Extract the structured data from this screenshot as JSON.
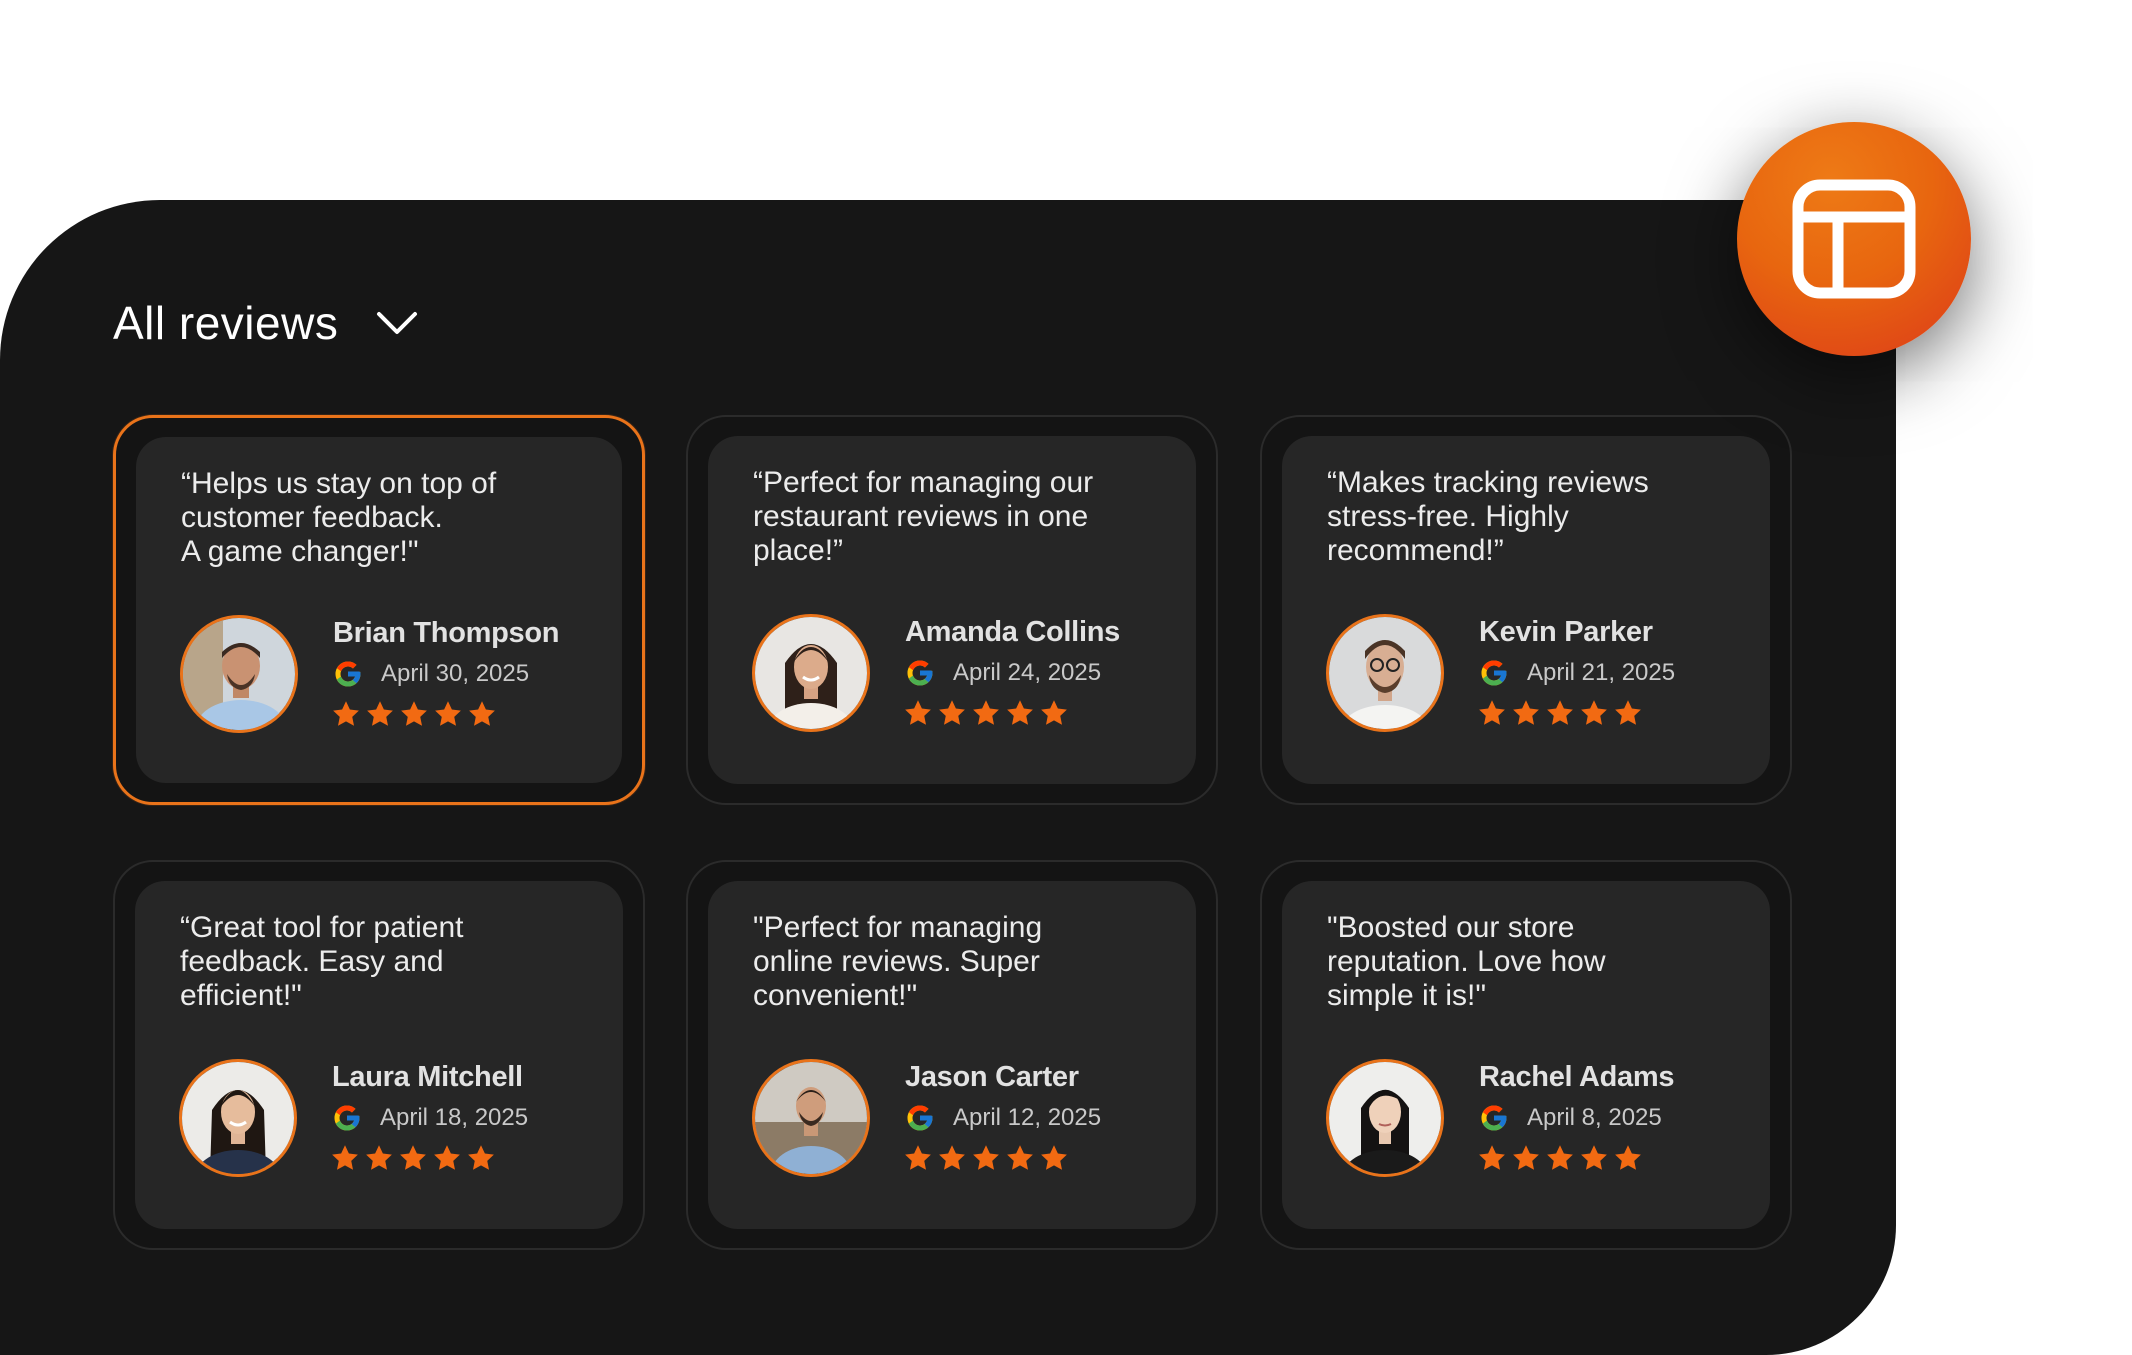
{
  "header": {
    "title": "All reviews"
  },
  "colors": {
    "accent": "#e9731a",
    "panel_bg": "#161616",
    "card_bg": "#262626",
    "star": "#f26a12"
  },
  "icons": {
    "badge": "widget-layout-icon",
    "dropdown": "chevron-down-icon",
    "source": "google-icon",
    "rating": "star-icon"
  },
  "reviews": [
    {
      "quote": "“Helps us stay on top of\ncustomer feedback.\nA game changer!\"",
      "name": "Brian Thompson",
      "date": "April 30, 2025",
      "rating": 5
    },
    {
      "quote": "“Perfect for managing our\nrestaurant reviews in one\nplace!”",
      "name": "Amanda Collins",
      "date": "April 24, 2025",
      "rating": 5
    },
    {
      "quote": "“Makes tracking reviews\nstress-free. Highly\nrecommend!”",
      "name": "Kevin Parker",
      "date": "April 21, 2025",
      "rating": 5
    },
    {
      "quote": "“Great tool for patient\nfeedback. Easy and\nefficient!\"",
      "name": "Laura Mitchell",
      "date": "April 18, 2025",
      "rating": 5
    },
    {
      "quote": "\"Perfect for managing\nonline reviews. Super\nconvenient!\"",
      "name": "Jason Carter",
      "date": "April 12, 2025",
      "rating": 5
    },
    {
      "quote": "\"Boosted our store\nreputation. Love how\nsimple it is!\"",
      "name": "Rachel Adams",
      "date": "April 8, 2025",
      "rating": 5
    }
  ]
}
